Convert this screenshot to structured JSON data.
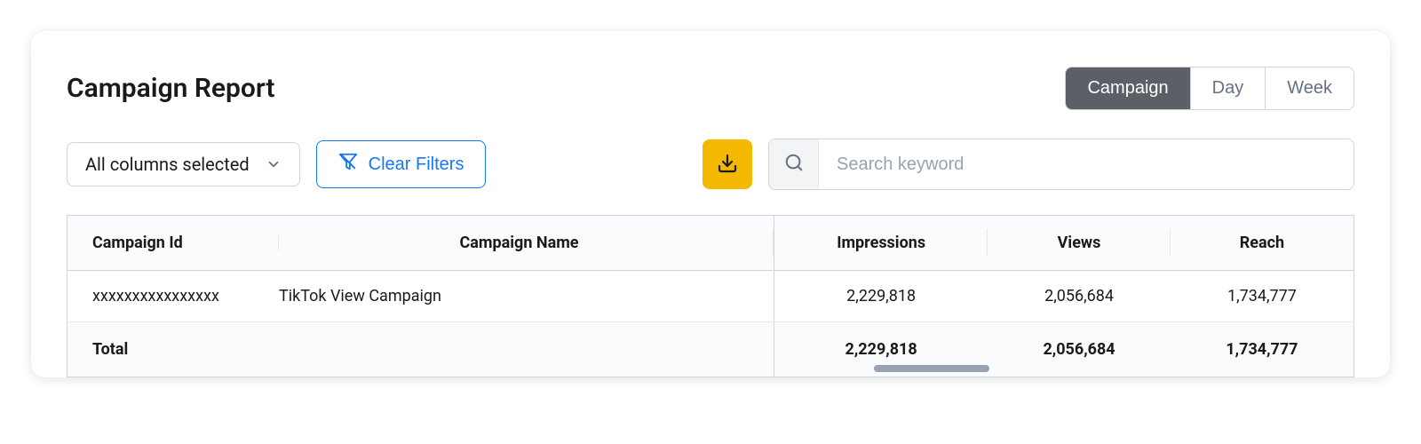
{
  "title": "Campaign Report",
  "tabs": {
    "campaign": "Campaign",
    "day": "Day",
    "week": "Week",
    "active": "campaign"
  },
  "controls": {
    "columns_dropdown": "All columns selected",
    "clear_filters": "Clear Filters",
    "search_placeholder": "Search keyword"
  },
  "table": {
    "headers": {
      "campaign_id": "Campaign Id",
      "campaign_name": "Campaign Name",
      "impressions": "Impressions",
      "views": "Views",
      "reach": "Reach"
    },
    "rows": [
      {
        "campaign_id": "xxxxxxxxxxxxxxxx",
        "campaign_name": "TikTok View Campaign",
        "impressions": "2,229,818",
        "views": "2,056,684",
        "reach": "1,734,777"
      }
    ],
    "total": {
      "label": "Total",
      "impressions": "2,229,818",
      "views": "2,056,684",
      "reach": "1,734,777"
    }
  },
  "colors": {
    "accent_blue": "#1877f2",
    "accent_yellow": "#f5b800",
    "tab_active": "#5b5f66"
  }
}
